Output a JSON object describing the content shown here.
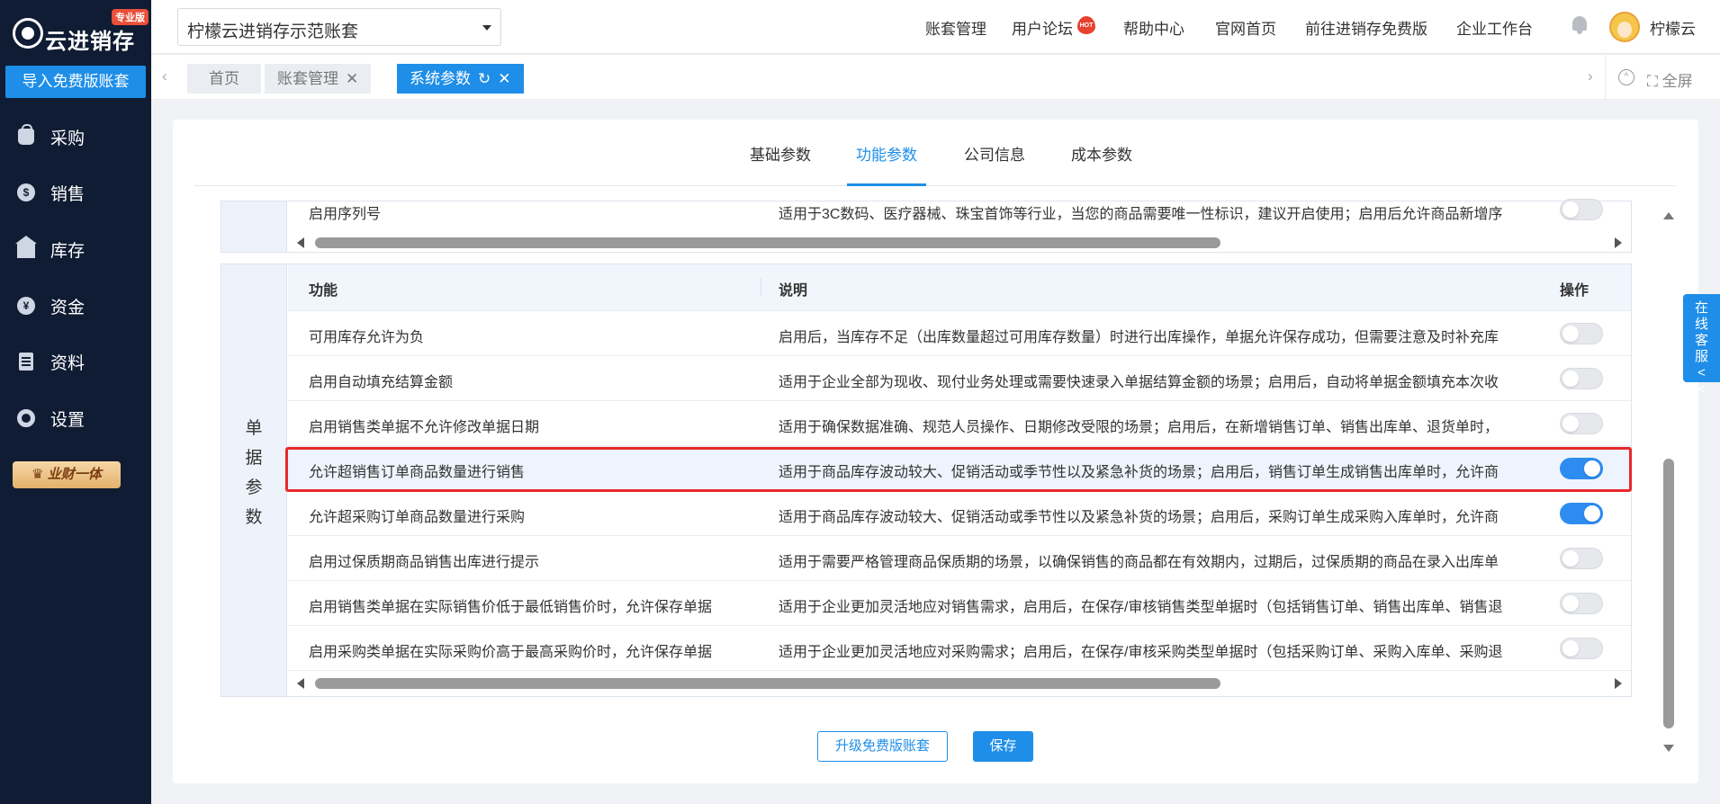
{
  "sidebar": {
    "logo_text": "云进销存",
    "edition": "专业版",
    "import_button": "导入免费版账套",
    "items": [
      {
        "label": "采购"
      },
      {
        "label": "销售"
      },
      {
        "label": "库存"
      },
      {
        "label": "资金"
      },
      {
        "label": "资料"
      },
      {
        "label": "设置"
      }
    ],
    "promo_badge": "业财一体"
  },
  "header": {
    "account_select_value": "柠檬云进销存示范账套",
    "nav": [
      {
        "label": "账套管理"
      },
      {
        "label": "用户论坛",
        "badge": "HOT"
      },
      {
        "label": "帮助中心"
      },
      {
        "label": "官网首页"
      },
      {
        "label": "前往进销存免费版"
      },
      {
        "label": "企业工作台"
      }
    ],
    "username": "柠檬云"
  },
  "tabbar": {
    "tabs": [
      {
        "label": "首页",
        "active": false
      },
      {
        "label": "账套管理",
        "active": false
      },
      {
        "label": "系统参数",
        "active": true
      }
    ],
    "fullscreen": "全屏"
  },
  "sub_tabs": [
    {
      "label": "基础参数",
      "active": false
    },
    {
      "label": "功能参数",
      "active": true
    },
    {
      "label": "公司信息",
      "active": false
    },
    {
      "label": "成本参数",
      "active": false
    }
  ],
  "prev_group": {
    "row": {
      "feature": "启用序列号",
      "desc": "适用于3C数码、医疗器械、珠宝首饰等行业，当您的商品需要唯一性标识，建议开启使用；启用后允许商品新增序",
      "enabled": false
    }
  },
  "group": {
    "label": "单据参数",
    "headers": {
      "feature": "功能",
      "desc": "说明",
      "action": "操作"
    },
    "rows": [
      {
        "feature": "可用库存允许为负",
        "desc": "启用后，当库存不足（出库数量超过可用库存数量）时进行出库操作，单据允许保存成功，但需要注意及时补充库",
        "enabled": false
      },
      {
        "feature": "启用自动填充结算金额",
        "desc": "适用于企业全部为现收、现付业务处理或需要快速录入单据结算金额的场景；启用后，自动将单据金额填充本次收",
        "enabled": false
      },
      {
        "feature": "启用销售类单据不允许修改单据日期",
        "desc": "适用于确保数据准确、规范人员操作、日期修改受限的场景；启用后，在新增销售订单、销售出库单、退货单时，",
        "enabled": false
      },
      {
        "feature": "允许超销售订单商品数量进行销售",
        "desc": "适用于商品库存波动较大、促销活动或季节性以及紧急补货的场景；启用后，销售订单生成销售出库单时，允许商",
        "enabled": true
      },
      {
        "feature": "允许超采购订单商品数量进行采购",
        "desc": "适用于商品库存波动较大、促销活动或季节性以及紧急补货的场景；启用后，采购订单生成采购入库单时，允许商",
        "enabled": true
      },
      {
        "feature": "启用过保质期商品销售出库进行提示",
        "desc": "适用于需要严格管理商品保质期的场景，以确保销售的商品都在有效期内，过期后，过保质期的商品在录入出库单",
        "enabled": false
      },
      {
        "feature": "启用销售类单据在实际销售价低于最低销售价时，允许保存单据",
        "desc": "适用于企业更加灵活地应对销售需求，启用后，在保存/审核销售类型单据时（包括销售订单、销售出库单、销售退",
        "enabled": false
      },
      {
        "feature": "启用采购类单据在实际采购价高于最高采购价时，允许保存单据",
        "desc": "适用于企业更加灵活地应对采购需求；启用后，在保存/审核采购类型单据时（包括采购订单、采购入库单、采购退",
        "enabled": false
      }
    ]
  },
  "footer": {
    "upgrade_button": "升级免费版账套",
    "save_button": "保存"
  },
  "online_service": "在线客服<<",
  "colors": {
    "primary": "#1e8ee8",
    "sidebar_bg": "#0f1c33",
    "highlight": "#e8282a"
  }
}
